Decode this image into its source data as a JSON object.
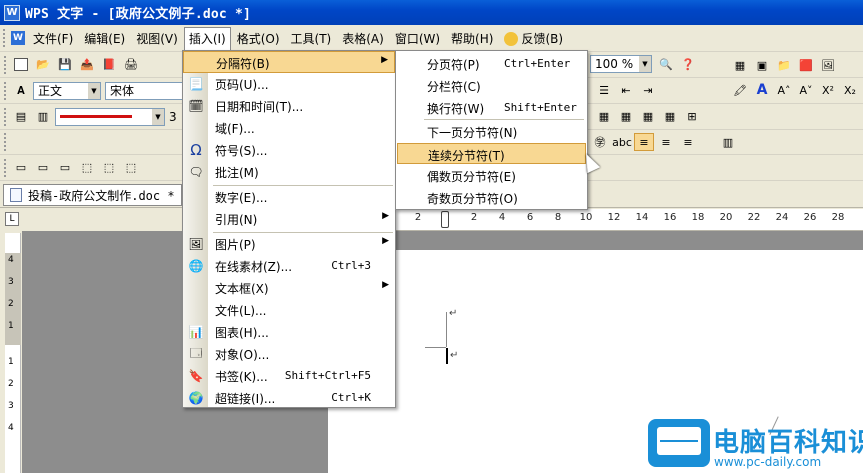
{
  "window": {
    "logo_text": "W",
    "title": "WPS 文字 - [政府公文例子.doc *]"
  },
  "menubar": {
    "items": [
      {
        "label": "文件(F)"
      },
      {
        "label": "编辑(E)"
      },
      {
        "label": "视图(V)"
      },
      {
        "label": "插入(I)"
      },
      {
        "label": "格式(O)"
      },
      {
        "label": "工具(T)"
      },
      {
        "label": "表格(A)"
      },
      {
        "label": "窗口(W)"
      },
      {
        "label": "帮助(H)"
      },
      {
        "label": "反馈(B)"
      }
    ],
    "active_index": 3
  },
  "toolbar": {
    "style_value": "正文",
    "font_value": "宋体",
    "zoom_value": "100 %",
    "line_width_value": "3"
  },
  "document_tab": {
    "label": "投稿-政府公文制作.doc *"
  },
  "ruler": {
    "ticks": [
      "2",
      "2",
      "4",
      "6",
      "8",
      "10",
      "12",
      "14",
      "16",
      "18",
      "20",
      "22",
      "24",
      "26",
      "28"
    ],
    "vticks": [
      "4",
      "3",
      "2",
      "1",
      "1",
      "2",
      "3",
      "4"
    ]
  },
  "insert_menu": {
    "items": [
      {
        "label": "分隔符(B)",
        "shortcut": "",
        "icon": "none",
        "has_submenu": true,
        "highlighted": true
      },
      {
        "label": "页码(U)...",
        "shortcut": "",
        "icon": "page-number-icon",
        "has_submenu": false
      },
      {
        "label": "日期和时间(T)...",
        "shortcut": "",
        "icon": "date-time-icon",
        "has_submenu": false
      },
      {
        "label": "域(F)...",
        "shortcut": "",
        "icon": "none",
        "has_submenu": false
      },
      {
        "label": "符号(S)...",
        "shortcut": "",
        "icon": "omega-icon",
        "has_submenu": false
      },
      {
        "label": "批注(M)",
        "shortcut": "",
        "icon": "comment-icon",
        "has_submenu": false
      },
      {
        "label": "数字(E)...",
        "shortcut": "",
        "icon": "none",
        "has_submenu": false
      },
      {
        "label": "引用(N)",
        "shortcut": "",
        "icon": "none",
        "has_submenu": true
      },
      {
        "label": "图片(P)",
        "shortcut": "",
        "icon": "picture-icon",
        "has_submenu": true
      },
      {
        "label": "在线素材(Z)...",
        "shortcut": "Ctrl+3",
        "icon": "online-material-icon",
        "has_submenu": false
      },
      {
        "label": "文本框(X)",
        "shortcut": "",
        "icon": "none",
        "has_submenu": true
      },
      {
        "label": "文件(L)...",
        "shortcut": "",
        "icon": "none",
        "has_submenu": false
      },
      {
        "label": "图表(H)...",
        "shortcut": "",
        "icon": "chart-icon",
        "has_submenu": false
      },
      {
        "label": "对象(O)...",
        "shortcut": "",
        "icon": "object-icon",
        "has_submenu": false
      },
      {
        "label": "书签(K)...",
        "shortcut": "Shift+Ctrl+F5",
        "icon": "bookmark-icon",
        "has_submenu": false
      },
      {
        "label": "超链接(I)...",
        "shortcut": "Ctrl+K",
        "icon": "hyperlink-icon",
        "has_submenu": false
      }
    ]
  },
  "separator_submenu": {
    "items": [
      {
        "label": "分页符(P)",
        "shortcut": "Ctrl+Enter"
      },
      {
        "label": "分栏符(C)",
        "shortcut": ""
      },
      {
        "label": "换行符(W)",
        "shortcut": "Shift+Enter"
      },
      {
        "label": "下一页分节符(N)",
        "shortcut": ""
      },
      {
        "label": "连续分节符(T)",
        "shortcut": "",
        "highlighted": true
      },
      {
        "label": "偶数页分节符(E)",
        "shortcut": ""
      },
      {
        "label": "奇数页分节符(O)",
        "shortcut": ""
      }
    ]
  },
  "paragraph_marks": [
    "↵",
    "↵"
  ],
  "watermark": {
    "title": "电脑百科知识",
    "url": "www.pc-daily.com"
  },
  "colors": {
    "highlight": "#f8d893",
    "highlight_border": "#d29b3a",
    "titlebar": "#0a5fd8",
    "watermark": "#1a8fd7"
  }
}
